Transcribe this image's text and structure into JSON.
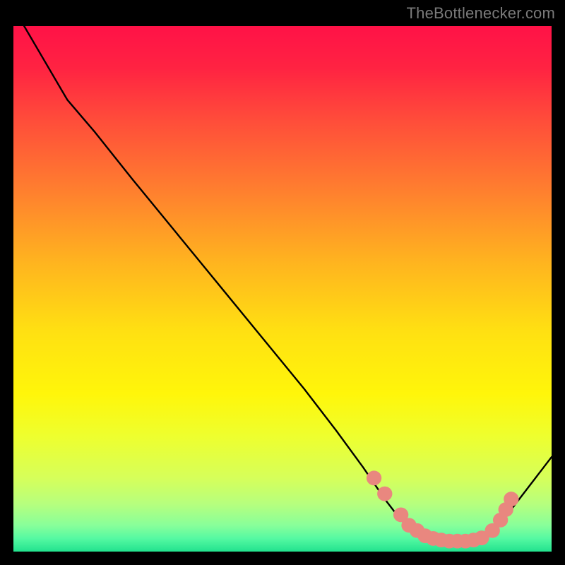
{
  "attribution": "TheBottlenecker.com",
  "chart_data": {
    "type": "line",
    "title": "",
    "xlabel": "",
    "ylabel": "",
    "xlim": [
      0,
      100
    ],
    "ylim": [
      0,
      100
    ],
    "background_gradient_stops": [
      {
        "offset": 0.0,
        "color": "#ff1247"
      },
      {
        "offset": 0.08,
        "color": "#ff2342"
      },
      {
        "offset": 0.18,
        "color": "#ff4d3a"
      },
      {
        "offset": 0.3,
        "color": "#ff7a30"
      },
      {
        "offset": 0.45,
        "color": "#ffb41f"
      },
      {
        "offset": 0.58,
        "color": "#ffe012"
      },
      {
        "offset": 0.7,
        "color": "#fff60a"
      },
      {
        "offset": 0.78,
        "color": "#eeff2e"
      },
      {
        "offset": 0.86,
        "color": "#d6ff5a"
      },
      {
        "offset": 0.91,
        "color": "#b6ff7e"
      },
      {
        "offset": 0.95,
        "color": "#88ff9a"
      },
      {
        "offset": 0.975,
        "color": "#55f9a2"
      },
      {
        "offset": 1.0,
        "color": "#22e28e"
      }
    ],
    "series": [
      {
        "name": "curve",
        "color": "#000000",
        "points": [
          {
            "x": 2,
            "y": 100
          },
          {
            "x": 6,
            "y": 93
          },
          {
            "x": 10,
            "y": 86
          },
          {
            "x": 15,
            "y": 80
          },
          {
            "x": 22,
            "y": 71
          },
          {
            "x": 30,
            "y": 61
          },
          {
            "x": 38,
            "y": 51
          },
          {
            "x": 46,
            "y": 41
          },
          {
            "x": 54,
            "y": 31
          },
          {
            "x": 60,
            "y": 23
          },
          {
            "x": 65,
            "y": 16
          },
          {
            "x": 69,
            "y": 10
          },
          {
            "x": 72,
            "y": 6
          },
          {
            "x": 76,
            "y": 3
          },
          {
            "x": 80,
            "y": 2
          },
          {
            "x": 85,
            "y": 2
          },
          {
            "x": 88,
            "y": 3
          },
          {
            "x": 91,
            "y": 6
          },
          {
            "x": 94,
            "y": 10
          },
          {
            "x": 97,
            "y": 14
          },
          {
            "x": 100,
            "y": 18
          }
        ]
      }
    ],
    "markers": {
      "name": "highlight-points",
      "color": "#e9877f",
      "radius": 1.4,
      "points": [
        {
          "x": 67,
          "y": 14
        },
        {
          "x": 69,
          "y": 11
        },
        {
          "x": 72,
          "y": 7
        },
        {
          "x": 73.5,
          "y": 5
        },
        {
          "x": 75,
          "y": 4
        },
        {
          "x": 76.5,
          "y": 3
        },
        {
          "x": 78,
          "y": 2.5
        },
        {
          "x": 79.5,
          "y": 2.2
        },
        {
          "x": 81,
          "y": 2
        },
        {
          "x": 82.5,
          "y": 2
        },
        {
          "x": 84,
          "y": 2
        },
        {
          "x": 85.5,
          "y": 2.2
        },
        {
          "x": 87,
          "y": 2.6
        },
        {
          "x": 89,
          "y": 4
        },
        {
          "x": 90.5,
          "y": 6
        },
        {
          "x": 91.5,
          "y": 8
        },
        {
          "x": 92.5,
          "y": 10
        }
      ]
    }
  }
}
